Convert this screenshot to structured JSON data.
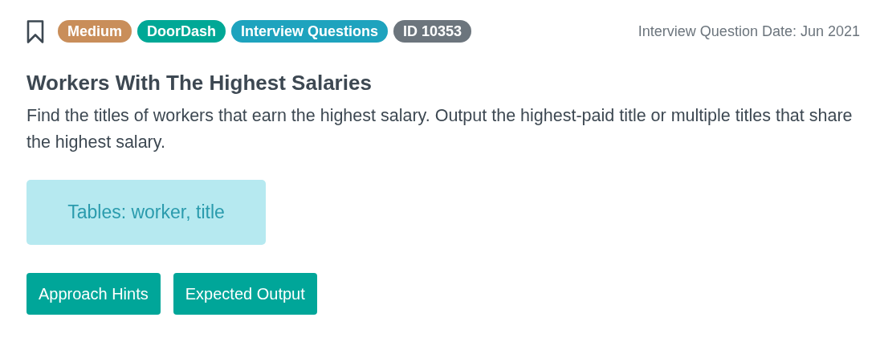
{
  "badges": [
    {
      "label": "Medium",
      "color": "#c98e5a"
    },
    {
      "label": "DoorDash",
      "color": "#00a896"
    },
    {
      "label": "Interview Questions",
      "color": "#1ea3be"
    },
    {
      "label": "ID 10353",
      "color": "#6c757d"
    }
  ],
  "date": "Interview Question Date: Jun 2021",
  "title": "Workers With The Highest Salaries",
  "description": "Find the titles of workers that earn the highest salary. Output the highest-paid title or multiple titles that share the highest salary.",
  "tables_note": "Tables: worker, title",
  "buttons": [
    "Approach Hints",
    "Expected Output"
  ]
}
